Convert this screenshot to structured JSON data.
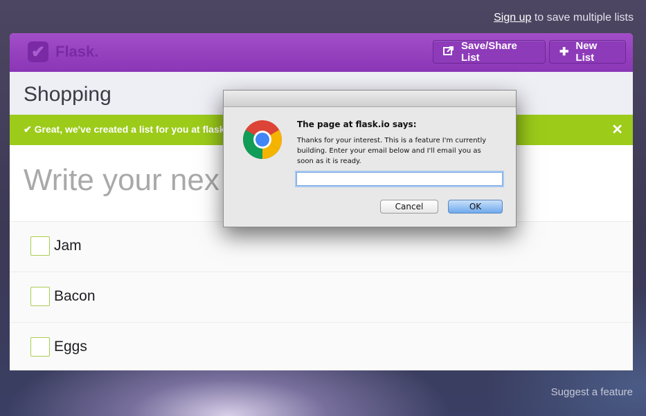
{
  "top": {
    "signup_link": "Sign up",
    "signup_rest": " to save multiple lists"
  },
  "header": {
    "logo_text": "Flask.",
    "save_share_label": "Save/Share List",
    "new_list_label": "New List"
  },
  "list": {
    "title": "Shopping",
    "alert_text": "Great, we've created a list for you at flask.i",
    "new_item_placeholder": "Write your nex",
    "items": [
      {
        "label": "Jam",
        "checked": false
      },
      {
        "label": "Bacon",
        "checked": false
      },
      {
        "label": "Eggs",
        "checked": false
      }
    ]
  },
  "footer": {
    "suggest_label": "Suggest a feature"
  },
  "dialog": {
    "heading": "The page at flask.io says:",
    "message": "Thanks for your interest. This is a feature I'm currently building. Enter your email below and I'll email you as soon as it is ready.",
    "input_value": "",
    "cancel_label": "Cancel",
    "ok_label": "OK"
  },
  "colors": {
    "header_purple": "#9a45c3",
    "alert_green": "#9ccb1a",
    "checkbox_border": "#a9cc50",
    "ok_blue": "#6fa9ec"
  },
  "icons": {
    "logo": "check-badge-icon",
    "save": "share-icon",
    "new": "plus-icon",
    "alert": "check-icon",
    "close": "close-icon",
    "dialog": "chrome-icon"
  }
}
